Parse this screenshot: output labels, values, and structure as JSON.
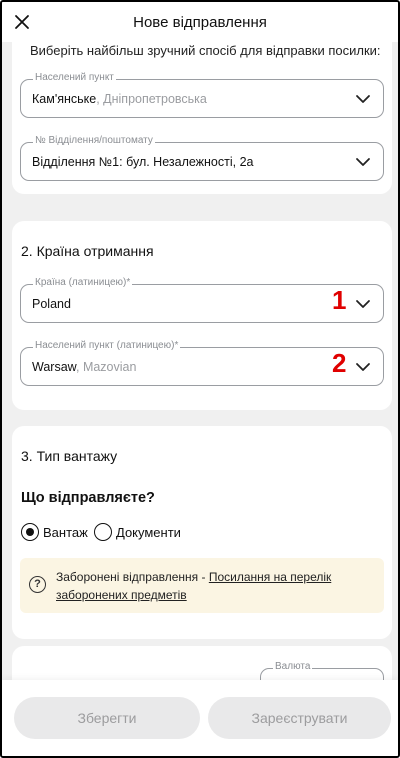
{
  "header": {
    "title": "Нове відправлення",
    "close_icon": "close-icon"
  },
  "sender": {
    "cut_text": "Виберіть найбільш зручний спосіб для відправки посилки:",
    "city": {
      "label": "Населений пункт",
      "value": "Кам'янське",
      "value_sub": ", Дніпропетровська"
    },
    "branch": {
      "label": "№ Відділення/поштомату",
      "value": "Відділення №1: бул. Незалежності, 2а"
    }
  },
  "destination": {
    "title": "2. Країна отримання",
    "country": {
      "label": "Країна (латиницею)*",
      "value": "Poland"
    },
    "city": {
      "label": "Населений пункт (латиницею)*",
      "value": "Warsaw",
      "value_sub": ", Mazovian"
    },
    "markers": [
      "1",
      "2"
    ]
  },
  "cargo": {
    "title": "3. Тип вантажу",
    "question": "Що відправляєте?",
    "options": [
      {
        "label": "Вантаж",
        "selected": true
      },
      {
        "label": "Документи",
        "selected": false
      }
    ],
    "notice": {
      "text": "Заборонені відправлення - ",
      "link": "Посилання на перелік заборонених предметів"
    }
  },
  "next_section": {
    "currency_label": "Валюта"
  },
  "footer": {
    "save_label": "Зберегти",
    "register_label": "Зареєструвати"
  },
  "colors": {
    "background": "#f0f0f0",
    "notice": "#fbf5e3",
    "marker": "#e00000",
    "button": "#e9e9ea"
  }
}
